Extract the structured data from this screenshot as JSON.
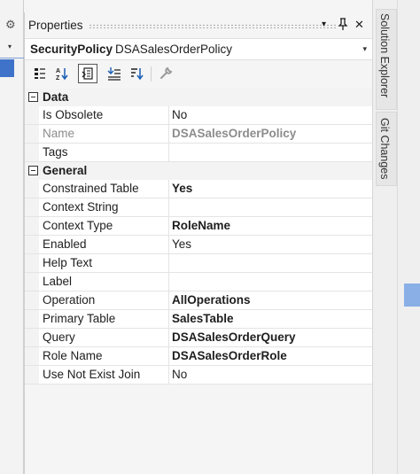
{
  "panel": {
    "title": "Properties",
    "pin_glyph": "‖",
    "dropdown_glyph": "▾",
    "close_glyph": "✕"
  },
  "selector": {
    "object_type": "SecurityPolicy",
    "object_name": "DSASalesOrderPolicy",
    "caret_glyph": "▾"
  },
  "left": {
    "gear_glyph": "⚙",
    "dropdown_glyph": "▾"
  },
  "toolbar": {
    "tools": [
      "categorized-icon",
      "alphabetical-icon",
      "properties-page-icon",
      "events-icon",
      "sort-icon",
      "wrench-icon"
    ]
  },
  "categories": [
    {
      "label": "Data",
      "rows": [
        {
          "name": "Is Obsolete",
          "value": "No",
          "bold": false,
          "disabled": false
        },
        {
          "name": "Name",
          "value": "DSASalesOrderPolicy",
          "bold": true,
          "disabled": true
        },
        {
          "name": "Tags",
          "value": "",
          "bold": false,
          "disabled": false
        }
      ]
    },
    {
      "label": "General",
      "rows": [
        {
          "name": "Constrained Table",
          "value": "Yes",
          "bold": true,
          "disabled": false
        },
        {
          "name": "Context String",
          "value": "",
          "bold": false,
          "disabled": false
        },
        {
          "name": "Context Type",
          "value": "RoleName",
          "bold": true,
          "disabled": false
        },
        {
          "name": "Enabled",
          "value": "Yes",
          "bold": false,
          "disabled": false
        },
        {
          "name": "Help Text",
          "value": "",
          "bold": false,
          "disabled": false
        },
        {
          "name": "Label",
          "value": "",
          "bold": false,
          "disabled": false
        },
        {
          "name": "Operation",
          "value": "AllOperations",
          "bold": true,
          "disabled": false
        },
        {
          "name": "Primary Table",
          "value": "SalesTable",
          "bold": true,
          "disabled": false
        },
        {
          "name": "Query",
          "value": "DSASalesOrderQuery",
          "bold": true,
          "disabled": false
        },
        {
          "name": "Role Name",
          "value": "DSASalesOrderRole",
          "bold": true,
          "disabled": false
        },
        {
          "name": "Use Not Exist Join",
          "value": "No",
          "bold": false,
          "disabled": false
        }
      ]
    }
  ],
  "side_tabs": {
    "solution_explorer": "Solution Explorer",
    "git_changes": "Git Changes"
  }
}
